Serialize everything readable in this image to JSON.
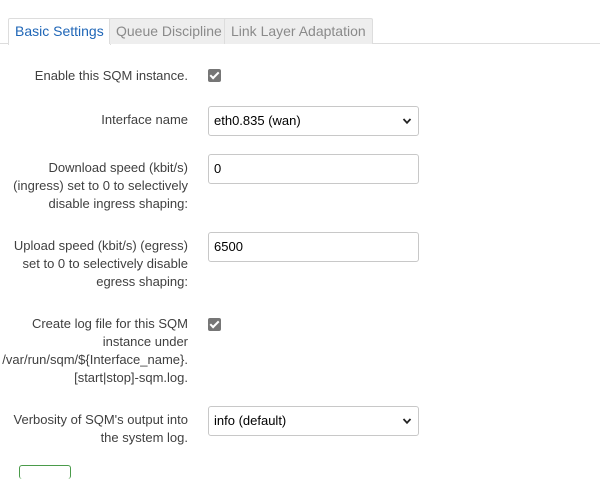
{
  "tabs": [
    {
      "label": "Basic Settings",
      "active": true
    },
    {
      "label": "Queue Discipline",
      "active": false
    },
    {
      "label": "Link Layer Adaptation",
      "active": false
    }
  ],
  "fields": {
    "enable": {
      "label": "Enable this SQM instance.",
      "checked": true
    },
    "interface": {
      "label": "Interface name",
      "value": "eth0.835 (wan)"
    },
    "download": {
      "line1": "Download speed (kbit/s)",
      "line2": "(ingress) set to 0 to selectively",
      "line3": "disable ingress shaping:",
      "value": "0"
    },
    "upload": {
      "line1": "Upload speed (kbit/s) (egress)",
      "line2": "set to 0 to selectively disable",
      "line3": "egress shaping:",
      "value": "6500"
    },
    "log": {
      "line1": "Create log file for this SQM",
      "line2": "instance under",
      "line3": "/var/run/sqm/${Interface_name}.",
      "line4": "[start|stop]-sqm.log.",
      "checked": true
    },
    "verbosity": {
      "line1": "Verbosity of SQM's output into",
      "line2": "the system log.",
      "value": "info (default)"
    }
  },
  "icons": {
    "checkbox": "checkmark-icon",
    "select": "chevron-down-icon"
  },
  "colors": {
    "accent": "#1f66b7",
    "tab_inactive_bg": "#eeeeee",
    "checkbox_fill": "#767676",
    "button_border": "#4a9b4a"
  }
}
